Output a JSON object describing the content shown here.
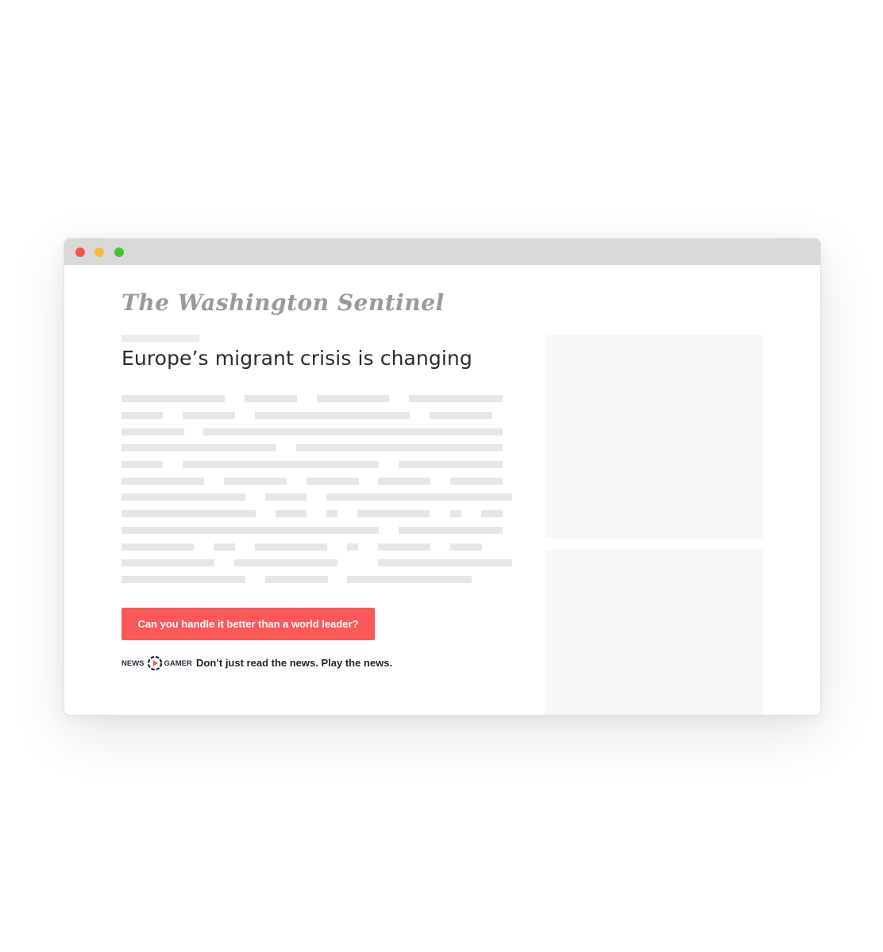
{
  "window": {
    "controls": [
      "close",
      "minimize",
      "maximize"
    ]
  },
  "article": {
    "masthead": "The Washington Sentinel",
    "headline": "Europe’s migrant crisis is changing",
    "cta_label": "Can you handle it better than a world leader?"
  },
  "brand": {
    "left": "NEWS",
    "right": "GAMER",
    "icon": "play-icon",
    "tagline": "Don’t just read the news. Play the news."
  },
  "colors": {
    "accent": "#fd5858",
    "placeholder": "#e6e6e6",
    "ad_background": "#f8f8f8"
  }
}
